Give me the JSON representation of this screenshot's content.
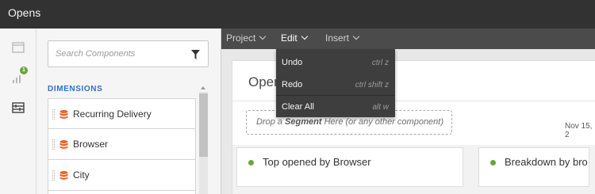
{
  "app": {
    "title": "Opens"
  },
  "rail": {
    "badge_count": "1"
  },
  "sidebar": {
    "search_placeholder": "Search Components",
    "section_header": "DIMENSIONS",
    "dimensions": [
      {
        "label": "Recurring Delivery"
      },
      {
        "label": "Browser"
      },
      {
        "label": "City"
      }
    ]
  },
  "menubar": {
    "project": "Project",
    "edit": "Edit",
    "insert": "Insert"
  },
  "edit_menu": {
    "undo": {
      "label": "Undo",
      "shortcut": "ctrl z"
    },
    "redo": {
      "label": "Redo",
      "shortcut": "ctrl shift z"
    },
    "clear_all": {
      "label": "Clear All",
      "shortcut": "alt w"
    }
  },
  "panel": {
    "title": "Opens",
    "drop_before": "Drop a ",
    "drop_bold": "Segment",
    "drop_after": " Here (or any other component)",
    "date": "Nov 15, 2"
  },
  "cards": [
    {
      "title": "Top opened by Browser"
    },
    {
      "title": "Breakdown by bro"
    }
  ],
  "colors": {
    "accent_green": "#6aa43b",
    "topbar": "#323232",
    "section_blue": "#2d72c8"
  }
}
